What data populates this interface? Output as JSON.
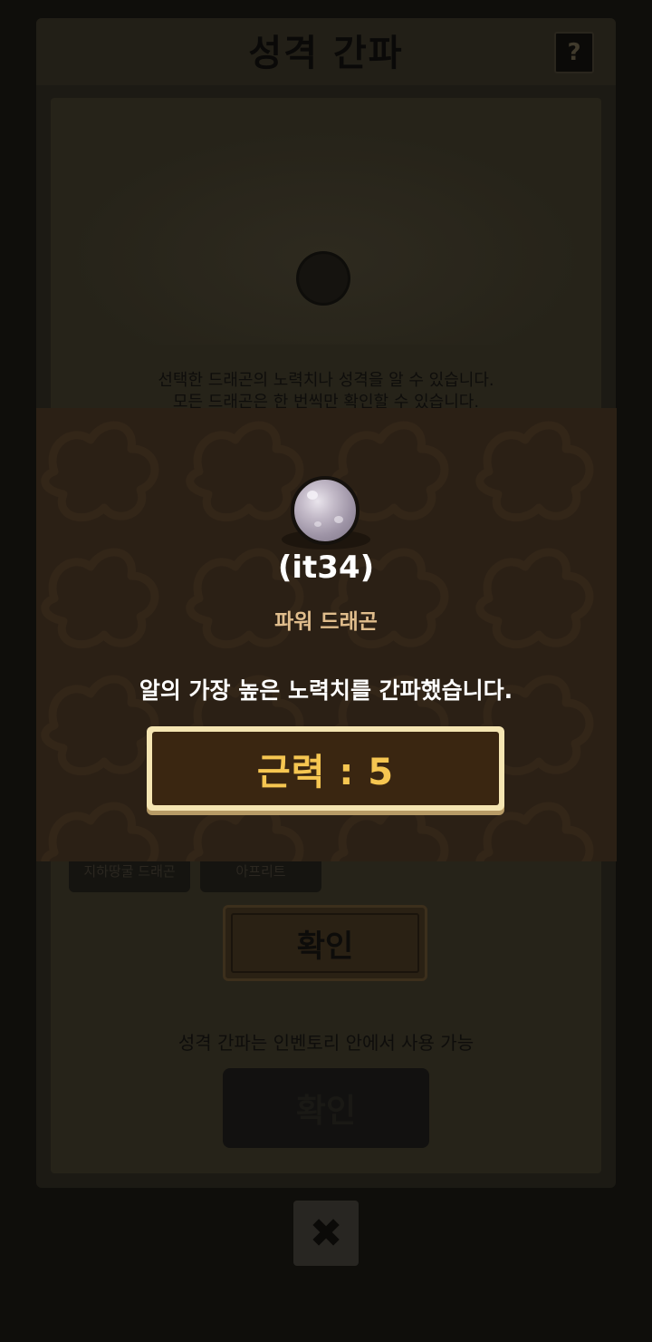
{
  "background": {
    "title": "성격 간파",
    "help_label": "?",
    "description_line1": "선택한 드래곤의 노력치나 성격을 알 수 있습니다.",
    "description_line2": "모든 드래곤은 한 번씩만 확인할 수 있습니다.",
    "chips": [
      "지하땅굴 드래곤",
      "아프리트"
    ],
    "confirm_label": "확인",
    "note": "성격 간파는 인벤토리 안에서 사용 가능",
    "confirm_label_2": "확인",
    "close_label": "✖"
  },
  "modal": {
    "egg_icon": "gray-dragon-egg",
    "egg_code": "(it34)",
    "egg_type": "파워 드래곤",
    "message": "알의 가장 높은 노력치를 간파했습니다.",
    "stat_result": "근력 : 5"
  },
  "colors": {
    "modal_bg": "#2b2015",
    "stat_text": "#f6c651",
    "stat_frame": "#f5e5b2",
    "egg_type_text": "#e0bd8c"
  }
}
